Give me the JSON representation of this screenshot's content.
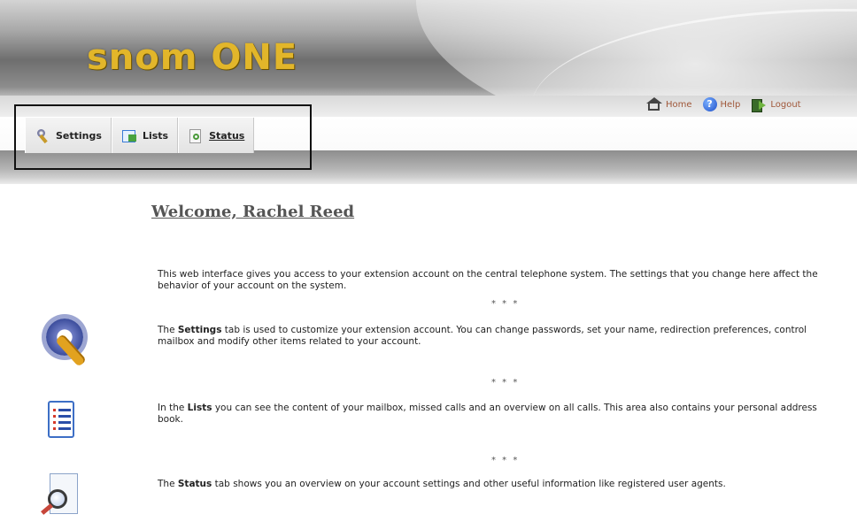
{
  "header": {
    "logo_text": "snom ONE",
    "links": [
      {
        "icon": "home-icon",
        "label": "Home"
      },
      {
        "icon": "help-icon",
        "label": "Help"
      },
      {
        "icon": "logout-icon",
        "label": "Logout"
      }
    ]
  },
  "tabs": [
    {
      "icon": "wrench-icon",
      "label": "Settings",
      "active": false
    },
    {
      "icon": "list-icon",
      "label": "Lists",
      "active": false
    },
    {
      "icon": "status-icon",
      "label": "Status",
      "active": true
    }
  ],
  "main": {
    "welcome": "Welcome, Rachel Reed",
    "intro": "This web interface gives you access to your extension account on the central telephone system. The settings that you change here affect the behavior of your account on the system.",
    "separator": "* * *",
    "settings_pre": "The ",
    "settings_bold": "Settings",
    "settings_post": " tab is used to customize your extension account. You can change passwords, set your name, redirection preferences, control mailbox and modify other items related to your account.",
    "lists_pre": "In the ",
    "lists_bold": "Lists",
    "lists_post": " you can see the content of your mailbox, missed calls and an overview on all calls. This area also contains your personal address book.",
    "status_pre": "The ",
    "status_bold": "Status",
    "status_post": " tab shows you an overview on your account settings and other useful information like registered user agents."
  },
  "colors": {
    "logo": "#e2b62a",
    "link": "#a0583a",
    "highlight_box": "#111111"
  }
}
